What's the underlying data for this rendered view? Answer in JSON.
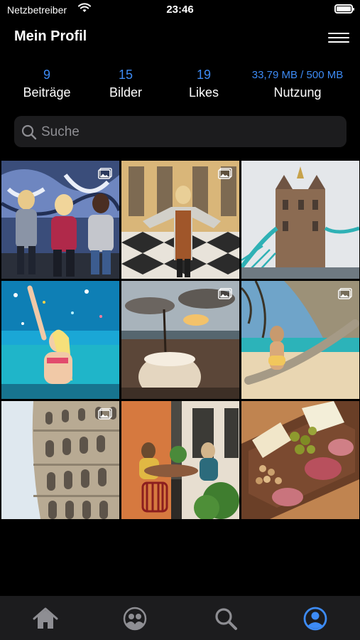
{
  "statusbar": {
    "carrier": "Netzbetreiber",
    "time": "23:46"
  },
  "header": {
    "title": "Mein Profil"
  },
  "stats": [
    {
      "value": "9",
      "label": "Beiträge"
    },
    {
      "value": "15",
      "label": "Bilder"
    },
    {
      "value": "19",
      "label": "Likes"
    },
    {
      "value": "33,79 MB / 500 MB",
      "label": "Nutzung"
    }
  ],
  "search": {
    "placeholder": "Suche"
  },
  "colors": {
    "accent": "#3d8bf5",
    "background": "#000000",
    "tabbar": "#1c1c1e"
  },
  "grid": {
    "photos": [
      {
        "subject": "three women in front of graffiti wall",
        "has_gallery_icon": true
      },
      {
        "subject": "woman in palace courtyard",
        "has_gallery_icon": true
      },
      {
        "subject": "Tower Bridge London",
        "has_gallery_icon": false
      },
      {
        "subject": "woman in pool with confetti",
        "has_gallery_icon": false
      },
      {
        "subject": "coconut drink at beach sunset",
        "has_gallery_icon": true
      },
      {
        "subject": "woman on tree at beach",
        "has_gallery_icon": true
      },
      {
        "subject": "Colosseum Rome",
        "has_gallery_icon": true
      },
      {
        "subject": "two women at street cafe",
        "has_gallery_icon": false
      },
      {
        "subject": "charcuterie board",
        "has_gallery_icon": false
      }
    ]
  },
  "tabbar": {
    "items": [
      {
        "icon": "home-icon",
        "active": false
      },
      {
        "icon": "friends-icon",
        "active": false
      },
      {
        "icon": "search-icon",
        "active": false
      },
      {
        "icon": "profile-icon",
        "active": true
      }
    ]
  }
}
